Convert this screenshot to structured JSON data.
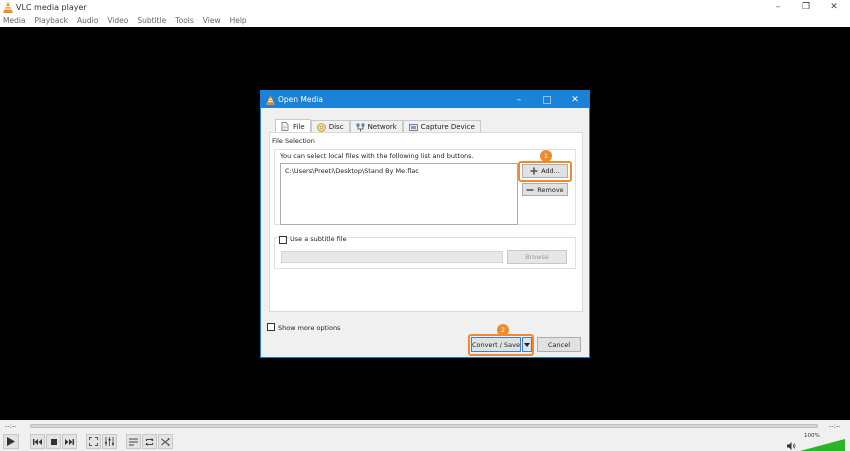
{
  "window": {
    "title": "VLC media player",
    "controls": {
      "minimize": "–",
      "restore": "❐",
      "close": "✕"
    }
  },
  "menu": [
    "Media",
    "Playback",
    "Audio",
    "Video",
    "Subtitle",
    "Tools",
    "View",
    "Help"
  ],
  "player": {
    "time_elapsed": "--:--",
    "time_total": "--:--",
    "volume": "100%",
    "volume_level": 1.0
  },
  "dialog": {
    "title": "Open Media",
    "tabs": [
      {
        "label": "File",
        "icon": "file-icon",
        "active": true
      },
      {
        "label": "Disc",
        "icon": "disc-icon",
        "active": false
      },
      {
        "label": "Network",
        "icon": "network-icon",
        "active": false
      },
      {
        "label": "Capture Device",
        "icon": "capture-device-icon",
        "active": false
      }
    ],
    "file_selection": {
      "label": "File Selection",
      "description": "You can select local files with the following list and buttons.",
      "files": [
        "C:\\Users\\Preeti\\Desktop\\Stand By Me.flac"
      ],
      "add_label": "Add...",
      "remove_label": "Remove"
    },
    "subtitle": {
      "checkbox_label": "Use a subtitle file",
      "checked": false,
      "file_value": "",
      "browse_label": "Browse"
    },
    "show_more_label": "Show more options",
    "convert_label": "Convert / Save",
    "cancel_label": "Cancel",
    "callouts": [
      "1",
      "2"
    ]
  },
  "colors": {
    "accent": "#1a83d8",
    "highlight": "#f08a2b",
    "vlc_orange": "#f28c1a"
  }
}
